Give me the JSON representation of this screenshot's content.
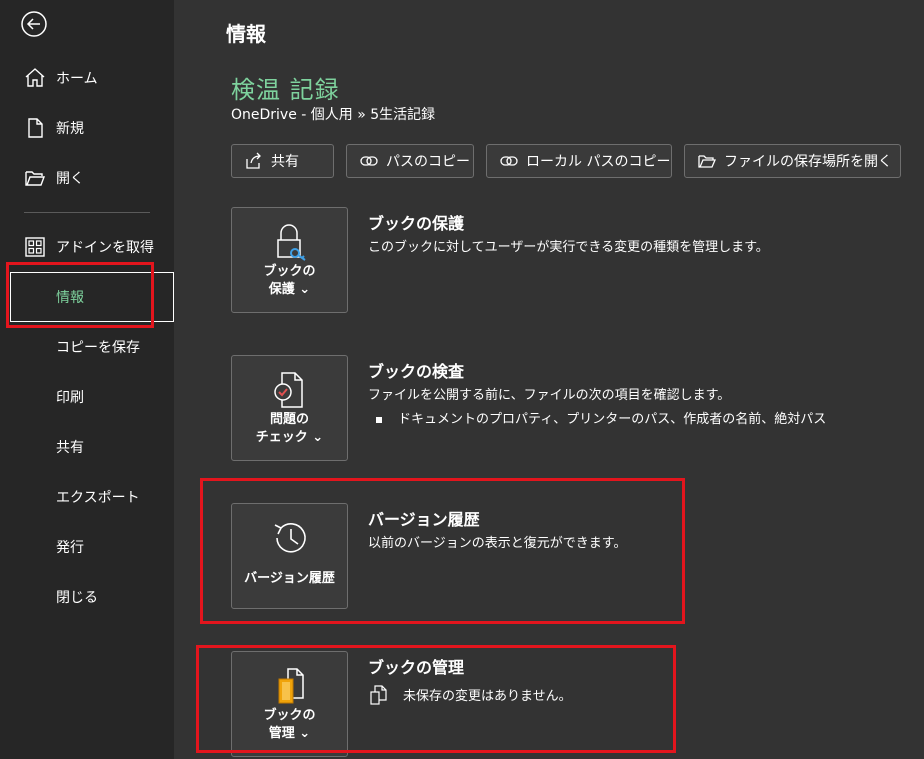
{
  "sidebar": {
    "items": [
      {
        "label": "ホーム",
        "icon": "home-icon"
      },
      {
        "label": "新規",
        "icon": "new-document-icon"
      },
      {
        "label": "開く",
        "icon": "folder-open-icon"
      },
      {
        "label": "アドインを取得",
        "icon": "addins-grid-icon"
      },
      {
        "label": "情報",
        "selected": true
      },
      {
        "label": "コピーを保存"
      },
      {
        "label": "印刷"
      },
      {
        "label": "共有"
      },
      {
        "label": "エクスポート"
      },
      {
        "label": "発行"
      },
      {
        "label": "閉じる"
      }
    ]
  },
  "main": {
    "page_title": "情報",
    "doc_title": "検温 記録",
    "doc_path": "OneDrive - 個人用 » 5生活記録",
    "actions": [
      {
        "label": "共有",
        "icon": "share-icon"
      },
      {
        "label": "パスのコピー",
        "icon": "link-icon"
      },
      {
        "label": "ローカル パスのコピー",
        "icon": "link-icon"
      },
      {
        "label": "ファイルの保存場所を開く",
        "icon": "folder-open-icon"
      }
    ],
    "sections": [
      {
        "button_line1": "ブックの",
        "button_line2": "保護 ⌄",
        "icon": "lock-key-icon",
        "title": "ブックの保護",
        "description": "このブックに対してユーザーが実行できる変更の種類を管理します。"
      },
      {
        "button_line1": "問題の",
        "button_line2": "チェック ⌄",
        "icon": "inspect-document-icon",
        "title": "ブックの検査",
        "description": "ファイルを公開する前に、ファイルの次の項目を確認します。",
        "bullet": "ドキュメントのプロパティ、プリンターのパス、作成者の名前、絶対パス"
      },
      {
        "button_line1": "バージョン履歴",
        "icon": "history-clock-icon",
        "title": "バージョン履歴",
        "description": "以前のバージョンの表示と復元ができます。"
      },
      {
        "button_line1": "ブックの",
        "button_line2": "管理 ⌄",
        "icon": "manage-workbook-icon",
        "title": "ブックの管理",
        "description": "未保存の変更はありません。",
        "status_icon": "document-status-icon"
      }
    ]
  },
  "colors": {
    "accent_green": "#7ed29d",
    "highlight_red": "#e3151d",
    "sidebar_bg": "#262626",
    "main_bg": "#333333"
  }
}
